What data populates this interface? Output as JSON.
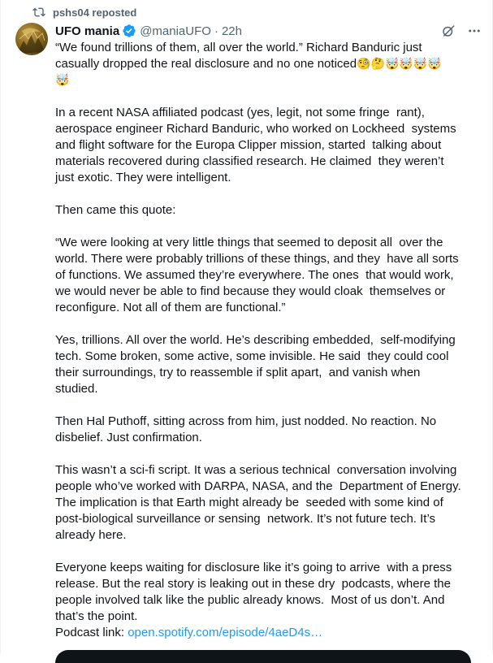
{
  "repost": {
    "text": "pshs04 reposted",
    "icon": "repost-icon"
  },
  "author": {
    "name": "UFO mania",
    "handle": "@maniaUFO",
    "separator": "·",
    "time": "22h"
  },
  "colors": {
    "link": "#1d9bf0",
    "verified": "#1d9bf0",
    "muted": "#536471"
  },
  "tweet": {
    "lines": [
      "“We found trillions of them, all over the world.” Richard Banduric just",
      "casually dropped the real disclosure and no one noticed",
      "🤯"
    ],
    "emojis_line2": "🧐🤔🤯🤯🤯🤯",
    "p2": [
      "In a recent NASA affiliated podcast (yes, legit, not some fringe  rant),",
      "aerospace engineer Richard Banduric, who worked on Lockheed  systems",
      "and flight software for the Europa Clipper mission, started  talking about",
      "materials recovered during classified research. He claimed  they weren’t",
      "just exotic. They were intelligent."
    ],
    "p3": [
      "Then came this quote:"
    ],
    "p4": [
      "“We were looking at very little things that seemed to deposit all  over the",
      "world. There were probably trillions of these things, and they  have all sorts",
      "of functions. We assumed they’re everywhere. The ones  that would work,",
      "we would never be able to find because they would cloak  themselves or",
      "reconfigure. Not all of them are functional.”"
    ],
    "p5": [
      "Yes, trillions. All over the world. He’s describing embedded,  self-modifying",
      "tech. Some broken, some active, some invisible. He said  they could cool",
      "their surroundings, try to reassemble if split apart,  and vanish when",
      "studied."
    ],
    "p6": [
      "Then Hal Puthoff, sitting across from him, just nodded. No reaction. No",
      "disbelief. Just confirmation."
    ],
    "p7": [
      "This wasn’t a sci-fi script. It was a serious technical  conversation involving",
      "people who’ve worked with DARPA, NASA, and the  Department of Energy.",
      "The implication is that Earth might already be  seeded with some kind of",
      "post-biological surveillance or sensing  network. It’s not future tech. It’s",
      "already here."
    ],
    "p8": [
      "Everyone keeps waiting for disclosure like it’s going to arrive  with a press",
      "release. But the real story is leaking out in these dry  podcasts, where the",
      "people involved talk like the public already knows.  Most of us don’t. And",
      "that’s the point."
    ],
    "podcast_label": "Podcast link: ",
    "podcast_link": "open.spotify.com/episode/4aeD4s…"
  }
}
